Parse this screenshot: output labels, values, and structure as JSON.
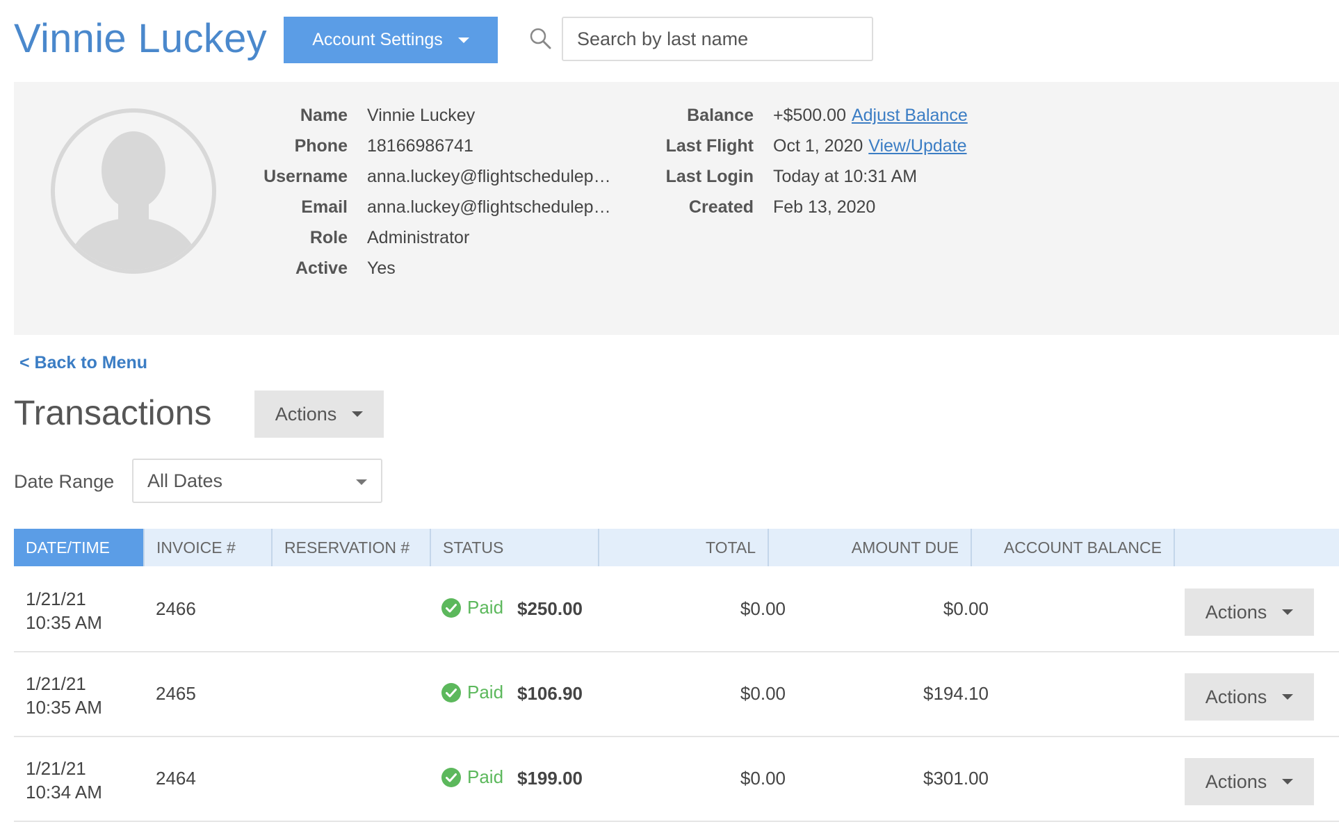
{
  "header": {
    "user_name": "Vinnie Luckey",
    "account_settings_label": "Account Settings",
    "search_placeholder": "Search by last name"
  },
  "profile": {
    "fields_left": [
      {
        "label": "Name",
        "value": "Vinnie Luckey"
      },
      {
        "label": "Phone",
        "value": "18166986741"
      },
      {
        "label": "Username",
        "value": "anna.luckey@flightschedulep…"
      },
      {
        "label": "Email",
        "value": "anna.luckey@flightschedulep…"
      },
      {
        "label": "Role",
        "value": "Administrator"
      },
      {
        "label": "Active",
        "value": "Yes"
      }
    ],
    "fields_right": [
      {
        "label": "Balance",
        "value": "+$500.00",
        "link": "Adjust Balance"
      },
      {
        "label": "Last Flight",
        "value": "Oct 1, 2020",
        "link": "View/Update"
      },
      {
        "label": "Last Login",
        "value": "Today at 10:31 AM"
      },
      {
        "label": "Created",
        "value": "Feb 13, 2020"
      }
    ]
  },
  "nav": {
    "back_label": "< Back to Menu"
  },
  "transactions": {
    "title": "Transactions",
    "actions_label": "Actions",
    "date_range_label": "Date Range",
    "date_range_value": "All Dates",
    "columns": [
      "DATE/TIME",
      "INVOICE #",
      "RESERVATION #",
      "STATUS",
      "TOTAL",
      "AMOUNT DUE",
      "ACCOUNT BALANCE"
    ],
    "rows": [
      {
        "date": "1/21/21",
        "time": "10:35 AM",
        "invoice": "2466",
        "reservation": "",
        "status": "Paid",
        "total": "$250.00",
        "amount_due": "$0.00",
        "account_balance": "$0.00",
        "action": "Actions"
      },
      {
        "date": "1/21/21",
        "time": "10:35 AM",
        "invoice": "2465",
        "reservation": "",
        "status": "Paid",
        "total": "$106.90",
        "amount_due": "$0.00",
        "account_balance": "$194.10",
        "action": "Actions"
      },
      {
        "date": "1/21/21",
        "time": "10:34 AM",
        "invoice": "2464",
        "reservation": "",
        "status": "Paid",
        "total": "$199.00",
        "amount_due": "$0.00",
        "account_balance": "$301.00",
        "action": "Actions"
      }
    ]
  },
  "colors": {
    "brand_blue": "#4a88cc",
    "button_blue": "#5b9de6",
    "paid_green": "#5cb85c",
    "header_row_bg": "#e3eefa"
  },
  "icons": {
    "search": "search-icon",
    "avatar": "avatar-placeholder-icon",
    "caret": "caret-down-icon",
    "status_paid": "check-circle-icon"
  }
}
